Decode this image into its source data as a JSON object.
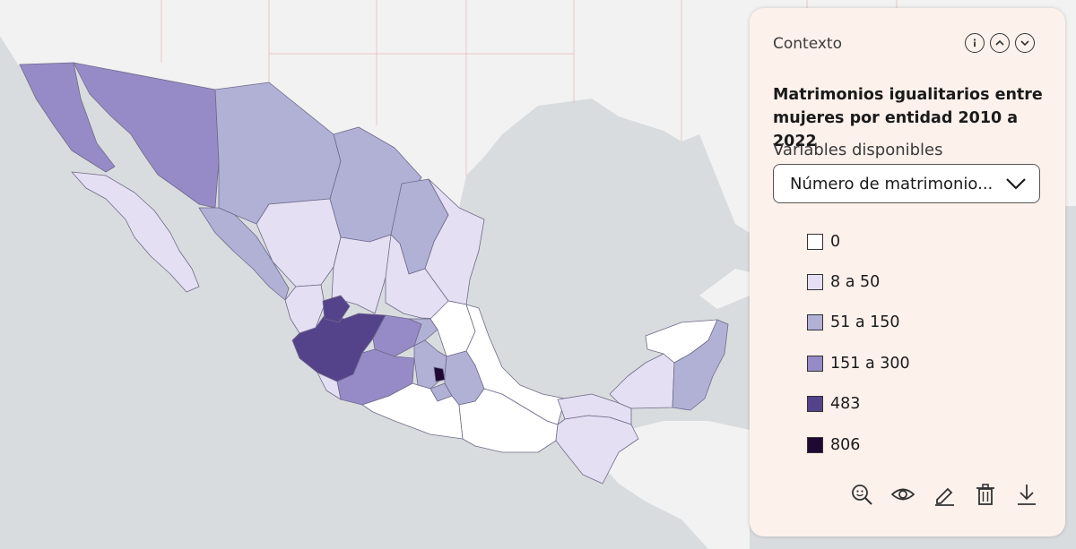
{
  "colors": {
    "sea": "#d9dcde",
    "land": "#f2f2f2",
    "class_0": "#ffffff",
    "class_8_50": "#e4dff2",
    "class_51_150": "#b1b1d6",
    "class_151_300": "#968bc6",
    "class_483": "#54438b",
    "class_806": "#1f0934"
  },
  "panel": {
    "context_label": "Contexto",
    "title": "Matrimonios igualitarios entre mujeres por entidad 2010 a 2022",
    "variables_label": "Variables disponibles",
    "selected_variable": "Número de matrimonio...",
    "header_icons": [
      "info-icon",
      "chevron-up-icon",
      "chevron-down-icon"
    ],
    "tool_icons": [
      "zoom-search-icon",
      "eye-icon",
      "pencil-icon",
      "trash-icon",
      "download-icon"
    ]
  },
  "legend": {
    "items": [
      {
        "label": "0",
        "color": "#ffffff"
      },
      {
        "label": "8 a 50",
        "color": "#e4dff2"
      },
      {
        "label": "51 a 150",
        "color": "#b1b1d6"
      },
      {
        "label": "151 a 300",
        "color": "#968bc6"
      },
      {
        "label": "483",
        "color": "#54438b"
      },
      {
        "label": "806",
        "color": "#1f0934"
      }
    ]
  },
  "map_states": [
    {
      "state": "Baja California",
      "class": "151 a 300"
    },
    {
      "state": "Sonora",
      "class": "151 a 300"
    },
    {
      "state": "Chihuahua",
      "class": "51 a 150"
    },
    {
      "state": "Coahuila",
      "class": "51 a 150"
    },
    {
      "state": "Nuevo León",
      "class": "51 a 150"
    },
    {
      "state": "Tamaulipas",
      "class": "8 a 50"
    },
    {
      "state": "Baja California Sur",
      "class": "8 a 50"
    },
    {
      "state": "Sinaloa",
      "class": "51 a 150"
    },
    {
      "state": "Durango",
      "class": "8 a 50"
    },
    {
      "state": "Zacatecas",
      "class": "8 a 50"
    },
    {
      "state": "San Luis Potosí",
      "class": "8 a 50"
    },
    {
      "state": "Nayarit",
      "class": "8 a 50"
    },
    {
      "state": "Aguascalientes",
      "class": "483"
    },
    {
      "state": "Jalisco",
      "class": "483"
    },
    {
      "state": "Guanajuato",
      "class": "151 a 300"
    },
    {
      "state": "Querétaro",
      "class": "51 a 150"
    },
    {
      "state": "Hidalgo",
      "class": "0"
    },
    {
      "state": "Michoacán",
      "class": "151 a 300"
    },
    {
      "state": "Colima",
      "class": "8 a 50"
    },
    {
      "state": "Estado de México",
      "class": "51 a 150"
    },
    {
      "state": "Ciudad de México",
      "class": "806"
    },
    {
      "state": "Morelos",
      "class": "51 a 150"
    },
    {
      "state": "Tlaxcala",
      "class": "51 a 150"
    },
    {
      "state": "Puebla",
      "class": "51 a 150"
    },
    {
      "state": "Guerrero",
      "class": "0"
    },
    {
      "state": "Oaxaca",
      "class": "0"
    },
    {
      "state": "Veracruz",
      "class": "0"
    },
    {
      "state": "Tabasco",
      "class": "8 a 50"
    },
    {
      "state": "Chiapas",
      "class": "8 a 50"
    },
    {
      "state": "Campeche",
      "class": "8 a 50"
    },
    {
      "state": "Yucatán",
      "class": "0"
    },
    {
      "state": "Quintana Roo",
      "class": "51 a 150"
    }
  ]
}
